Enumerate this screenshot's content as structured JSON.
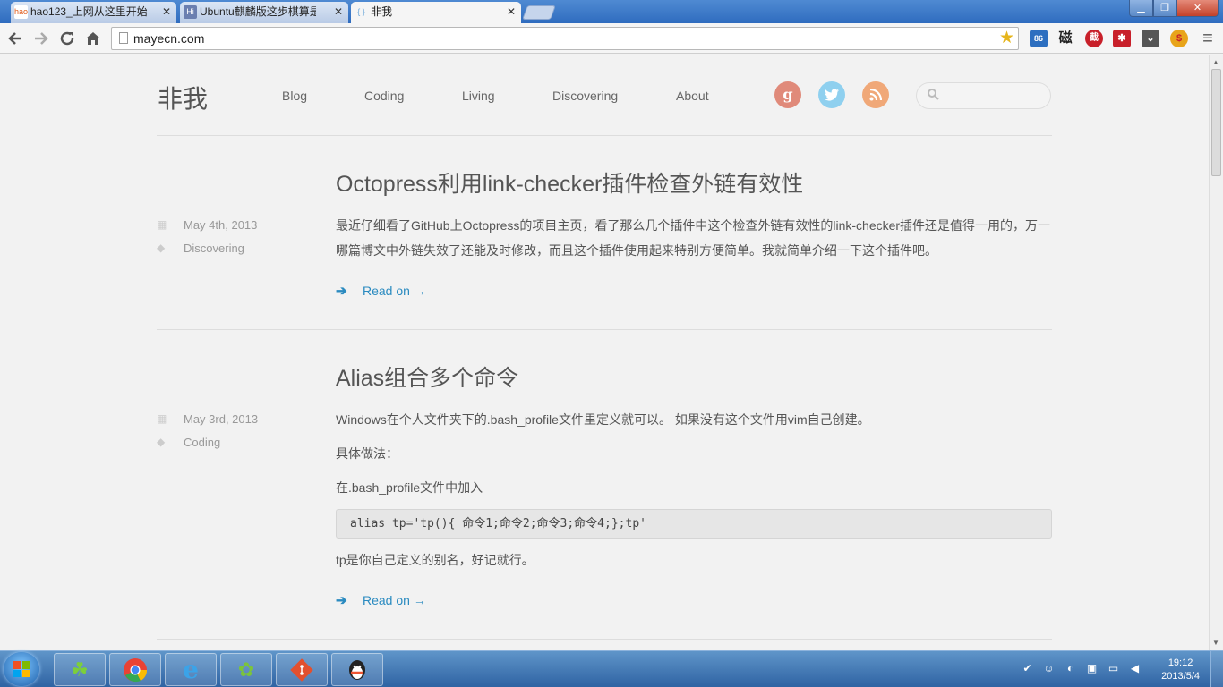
{
  "browser": {
    "tabs": [
      {
        "label": "hao123_上网从这里开始",
        "favicon": "hao",
        "close": "✕",
        "active": false
      },
      {
        "label": "Ubuntu麒麟版这步棋算是",
        "favicon": "Hi",
        "close": "✕",
        "active": false
      },
      {
        "label": "非我",
        "favicon": "{ }",
        "close": "✕",
        "active": true
      }
    ],
    "window_buttons": {
      "minimize": "▁",
      "maximize": "❐",
      "close": "✕"
    },
    "address": "mayecn.com",
    "nav_icons": [
      "back-icon",
      "forward-icon",
      "reload-icon",
      "home-icon"
    ],
    "extensions": [
      {
        "name": "notification-extension-icon",
        "label": "86",
        "color": "#2d6fc0"
      },
      {
        "name": "ci-dictionary-extension-icon",
        "label": "磁",
        "color": "#ffffff"
      },
      {
        "name": "red-seal-extension-icon",
        "label": "截",
        "color": "#c8202a"
      },
      {
        "name": "plus-extension-icon",
        "label": "✱",
        "color": "#c8202a"
      },
      {
        "name": "pocket-extension-icon",
        "label": "⌄",
        "color": "#555555"
      },
      {
        "name": "coin-extension-icon",
        "label": "$",
        "color": "#e8a41a"
      }
    ],
    "menu_icon": "≡"
  },
  "site": {
    "title": "非我",
    "nav": [
      "Blog",
      "Coding",
      "Living",
      "Discovering",
      "About"
    ],
    "social": [
      {
        "name": "google-plus-icon",
        "glyph": "g",
        "color": "#e08a7a"
      },
      {
        "name": "twitter-icon",
        "glyph": "🐦",
        "color": "#8fd0ef"
      },
      {
        "name": "rss-icon",
        "glyph": "◔",
        "color": "#f0a878"
      }
    ],
    "search_placeholder": ""
  },
  "posts": [
    {
      "title": "Octopress利用link-checker插件检查外链有效性",
      "date": "May 4th, 2013",
      "category": "Discovering",
      "paragraphs": [
        "最近仔细看了GitHub上Octopress的项目主页，看了那么几个插件中这个检查外链有效性的link-checker插件还是值得一用的，万一哪篇博文中外链失效了还能及时修改，而且这个插件使用起来特别方便简单。我就简单介绍一下这个插件吧。"
      ],
      "read_on": "Read on →"
    },
    {
      "title": "Alias组合多个命令",
      "date": "May 3rd, 2013",
      "category": "Coding",
      "paragraphs": [
        "Windows在个人文件夹下的.bash_profile文件里定义就可以。 如果没有这个文件用vim自己创建。",
        "具体做法：",
        "在.bash_profile文件中加入",
        "tp是你自己定义的别名，好记就行。"
      ],
      "code": "alias tp='tp(){ 命令1;命令2;命令3;命令4;};tp'",
      "read_on": "Read on →"
    }
  ],
  "taskbar": {
    "apps": [
      {
        "name": "clover-app",
        "glyph": "☘",
        "color": "#7ccf3a"
      },
      {
        "name": "chrome-app",
        "glyph": "◉",
        "color": "#e94235"
      },
      {
        "name": "ie-app",
        "glyph": "e",
        "color": "#3ba3e8"
      },
      {
        "name": "parrot-app",
        "glyph": "🦜",
        "color": "#7bc43b"
      },
      {
        "name": "git-app",
        "glyph": "◆",
        "color": "#e2502f"
      },
      {
        "name": "qq-app",
        "glyph": "🐧",
        "color": "#222222"
      }
    ],
    "tray": [
      "✔",
      "☺",
      "◐",
      "▣",
      "▭",
      "◀"
    ],
    "time": "19:12",
    "date": "2013/5/4"
  }
}
